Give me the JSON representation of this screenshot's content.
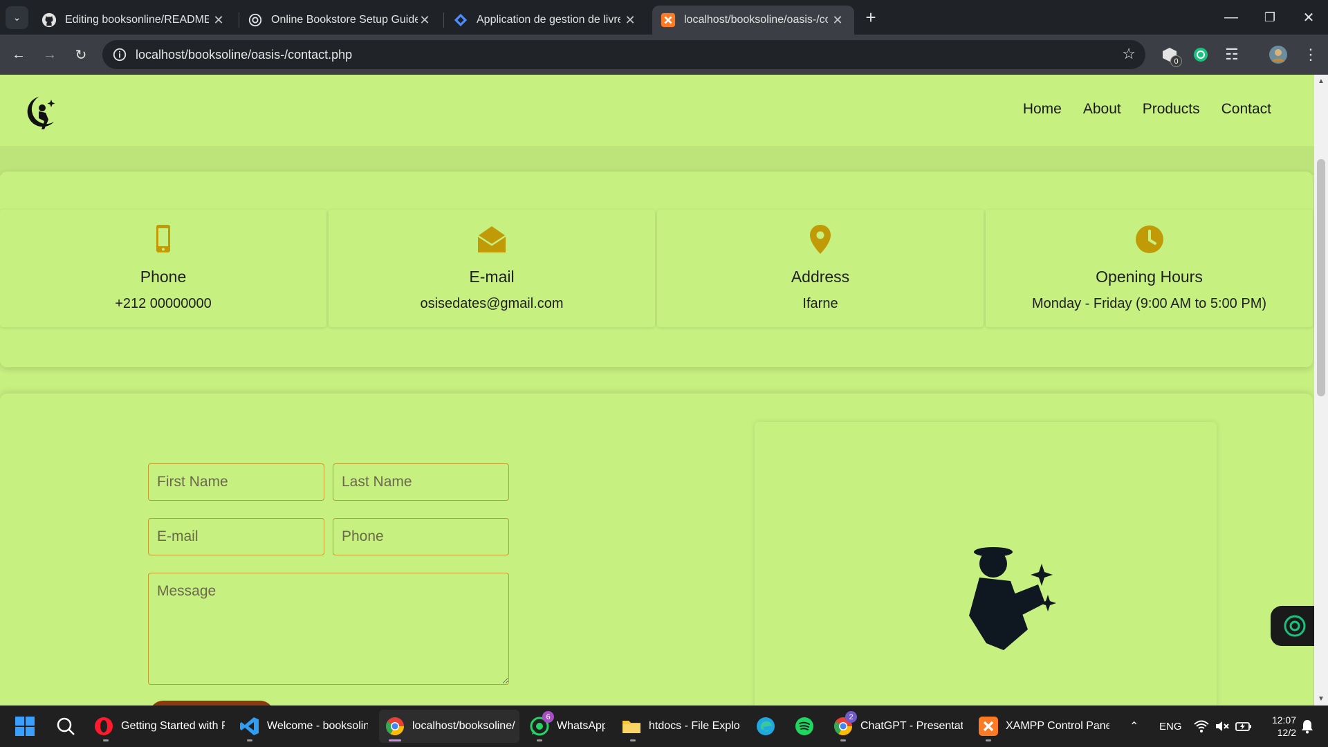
{
  "browser": {
    "tabs": [
      {
        "title": "Editing booksonline/README.md",
        "favicon": "github-icon"
      },
      {
        "title": "Online Bookstore Setup Guide",
        "favicon": "chatgpt-icon"
      },
      {
        "title": "Application de gestion de livres",
        "favicon": "jira-icon"
      },
      {
        "title": "localhost/booksoline/oasis-/contact.php",
        "favicon": "xampp-icon",
        "active": true
      }
    ],
    "url": "localhost/booksoline/oasis-/contact.php",
    "extension_badge": "0"
  },
  "site": {
    "nav": [
      "Home",
      "About",
      "Products",
      "Contact"
    ],
    "info": [
      {
        "icon": "mobile-phone-icon",
        "title": "Phone",
        "value": "+212 00000000"
      },
      {
        "icon": "envelope-open-icon",
        "title": "E-mail",
        "value": "osisedates@gmail.com"
      },
      {
        "icon": "map-pin-icon",
        "title": "Address",
        "value": "Ifarne"
      },
      {
        "icon": "clock-icon",
        "title": "Opening Hours",
        "value": "Monday - Friday (9:00 AM to 5:00 PM)"
      }
    ],
    "form": {
      "first_name_placeholder": "First Name",
      "last_name_placeholder": "Last Name",
      "email_placeholder": "E-mail",
      "phone_placeholder": "Phone",
      "message_placeholder": "Message"
    }
  },
  "taskbar": {
    "items": [
      {
        "label": "Getting Started with F",
        "icon": "opera-icon"
      },
      {
        "label": "Welcome - booksoline",
        "icon": "vscode-icon"
      },
      {
        "label": "localhost/booksoline/",
        "icon": "chrome-icon",
        "active": true
      },
      {
        "label": "WhatsApp",
        "icon": "whatsapp-icon",
        "badge": "6"
      },
      {
        "label": "htdocs - File Explorer",
        "icon": "folder-icon"
      },
      {
        "label": "ChatGPT - Presentation",
        "icon": "chrome-icon",
        "badge": "2"
      },
      {
        "label": "XAMPP Control Panel",
        "icon": "xampp-icon"
      }
    ],
    "lang": "ENG",
    "time": "12:07",
    "date": "12/2"
  },
  "colors": {
    "page_bg": "#c6f080",
    "icon_gold": "#c19a08",
    "border_gold": "#c19a2e",
    "button_brown": "#8b3a0f"
  }
}
